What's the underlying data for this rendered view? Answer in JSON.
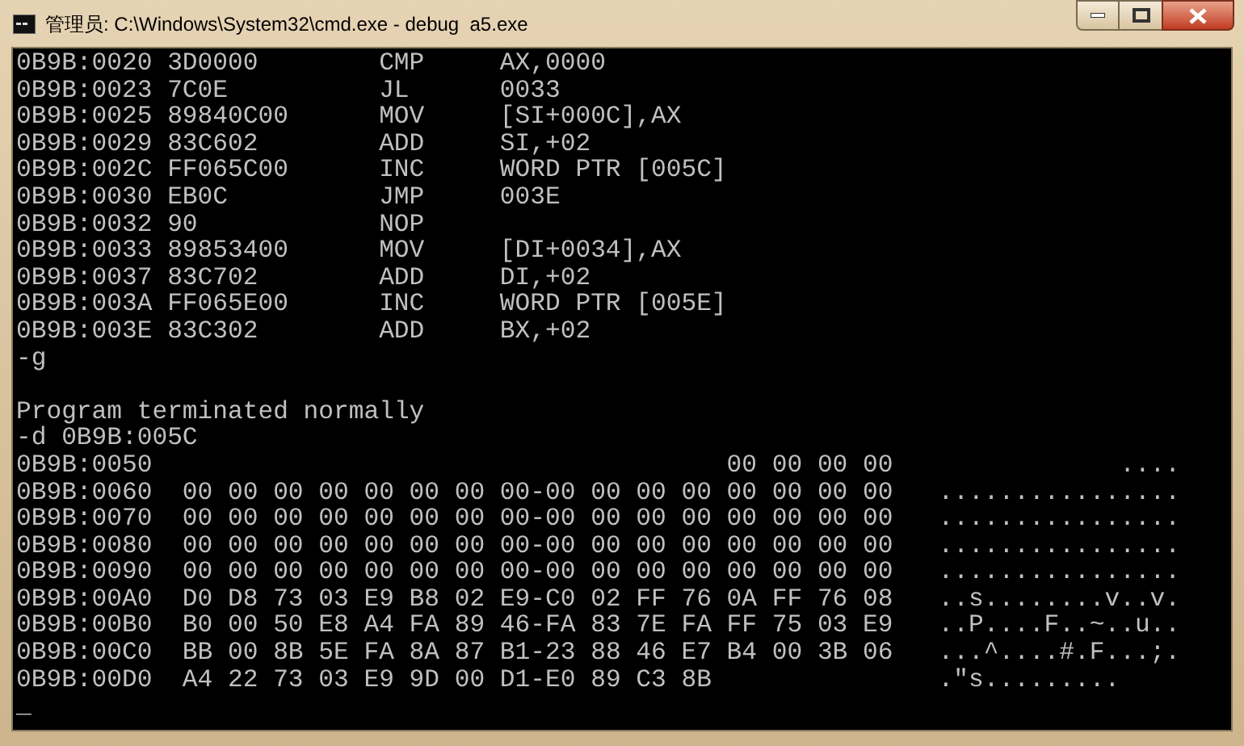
{
  "window": {
    "title": "管理员: C:\\Windows\\System32\\cmd.exe - debug  a5.exe"
  },
  "console": {
    "lines": [
      {
        "kind": "asm",
        "address": "0B9B:0020",
        "bytes": "3D0000",
        "mnemonic": "CMP",
        "operands": "AX,0000"
      },
      {
        "kind": "asm",
        "address": "0B9B:0023",
        "bytes": "7C0E",
        "mnemonic": "JL",
        "operands": "0033"
      },
      {
        "kind": "asm",
        "address": "0B9B:0025",
        "bytes": "89840C00",
        "mnemonic": "MOV",
        "operands": "[SI+000C],AX"
      },
      {
        "kind": "asm",
        "address": "0B9B:0029",
        "bytes": "83C602",
        "mnemonic": "ADD",
        "operands": "SI,+02"
      },
      {
        "kind": "asm",
        "address": "0B9B:002C",
        "bytes": "FF065C00",
        "mnemonic": "INC",
        "operands": "WORD PTR [005C]"
      },
      {
        "kind": "asm",
        "address": "0B9B:0030",
        "bytes": "EB0C",
        "mnemonic": "JMP",
        "operands": "003E"
      },
      {
        "kind": "asm",
        "address": "0B9B:0032",
        "bytes": "90",
        "mnemonic": "NOP"
      },
      {
        "kind": "asm",
        "address": "0B9B:0033",
        "bytes": "89853400",
        "mnemonic": "MOV",
        "operands": "[DI+0034],AX"
      },
      {
        "kind": "asm",
        "address": "0B9B:0037",
        "bytes": "83C702",
        "mnemonic": "ADD",
        "operands": "DI,+02"
      },
      {
        "kind": "asm",
        "address": "0B9B:003A",
        "bytes": "FF065E00",
        "mnemonic": "INC",
        "operands": "WORD PTR [005E]"
      },
      {
        "kind": "asm",
        "address": "0B9B:003E",
        "bytes": "83C302",
        "mnemonic": "ADD",
        "operands": "BX,+02"
      },
      {
        "kind": "text",
        "text": "-g"
      },
      {
        "kind": "blank"
      },
      {
        "kind": "text",
        "text": "Program terminated normally"
      },
      {
        "kind": "text",
        "text": "-d 0B9B:005C"
      },
      {
        "kind": "dump",
        "address": "0B9B:0050",
        "hex": "                                    00 00 00 00",
        "ascii": "            ...."
      },
      {
        "kind": "dump",
        "address": "0B9B:0060",
        "hex": "00 00 00 00 00 00 00 00-00 00 00 00 00 00 00 00",
        "ascii": "................"
      },
      {
        "kind": "dump",
        "address": "0B9B:0070",
        "hex": "00 00 00 00 00 00 00 00-00 00 00 00 00 00 00 00",
        "ascii": "................"
      },
      {
        "kind": "dump",
        "address": "0B9B:0080",
        "hex": "00 00 00 00 00 00 00 00-00 00 00 00 00 00 00 00",
        "ascii": "................"
      },
      {
        "kind": "dump",
        "address": "0B9B:0090",
        "hex": "00 00 00 00 00 00 00 00-00 00 00 00 00 00 00 00",
        "ascii": "................"
      },
      {
        "kind": "dump",
        "address": "0B9B:00A0",
        "hex": "D0 D8 73 03 E9 B8 02 E9-C0 02 FF 76 0A FF 76 08",
        "ascii": "..s........v..v."
      },
      {
        "kind": "dump",
        "address": "0B9B:00B0",
        "hex": "B0 00 50 E8 A4 FA 89 46-FA 83 7E FA FF 75 03 E9",
        "ascii": "..P....F..~..u.."
      },
      {
        "kind": "dump",
        "address": "0B9B:00C0",
        "hex": "BB 00 8B 5E FA 8A 87 B1-23 88 46 E7 B4 00 3B 06",
        "ascii": "...^....#.F...;."
      },
      {
        "kind": "dump",
        "address": "0B9B:00D0",
        "hex": "A4 22 73 03 E9 9D 00 D1-E0 89 C3 8B",
        "ascii": ".\"s........."
      },
      {
        "kind": "text",
        "text": "_"
      }
    ]
  }
}
